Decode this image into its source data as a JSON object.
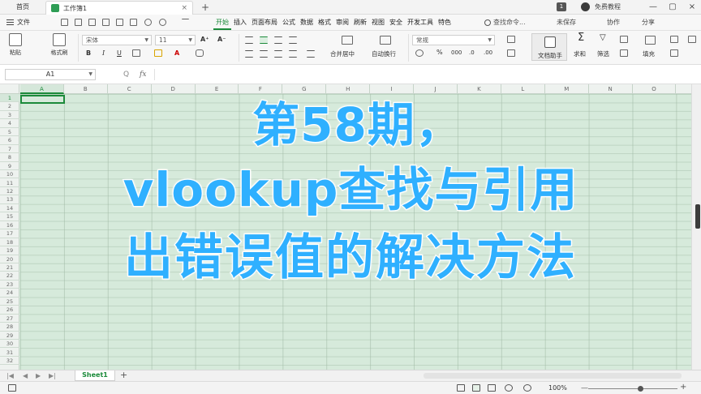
{
  "titlebar": {
    "home_tab": "首页",
    "doc_tab": "工作簿1",
    "close_glyph": "×",
    "add_tab_glyph": "+",
    "window_count": "1",
    "user_name": "免费教程",
    "window_controls": [
      "—",
      "▢",
      "×"
    ]
  },
  "menubar": {
    "file_label": "文件",
    "tabs": [
      {
        "label": "开始",
        "active": true
      },
      {
        "label": "插入",
        "active": false
      },
      {
        "label": "页面布局",
        "active": false
      },
      {
        "label": "公式",
        "active": false
      },
      {
        "label": "数据",
        "active": false
      },
      {
        "label": "格式",
        "active": false
      },
      {
        "label": "审阅",
        "active": false
      },
      {
        "label": "刷新",
        "active": false
      },
      {
        "label": "视图",
        "active": false
      },
      {
        "label": "安全",
        "active": false
      },
      {
        "label": "开发工具",
        "active": false
      },
      {
        "label": "特色",
        "active": false
      }
    ],
    "search_placeholder": "查找命令...",
    "save_status": "未保存",
    "collab": "协作",
    "share": "分享"
  },
  "ribbon": {
    "paste_label": "粘贴",
    "format_painter_label": "格式刷",
    "font_name": "宋体",
    "font_size": "11",
    "bold": "B",
    "italic": "I",
    "underline": "U",
    "merge_label": "合并居中",
    "wrap_label": "自动换行",
    "number_format": "常规",
    "percent": "%",
    "assistant_label": "文档助手",
    "sum_label": "求和",
    "filter_label": "筛选",
    "fill_label": "填充"
  },
  "formulabar": {
    "cell_ref": "A1",
    "fx_label": "fx",
    "zoom_glyph": "Q",
    "formula_value": ""
  },
  "grid": {
    "columns": [
      "A",
      "B",
      "C",
      "D",
      "E",
      "F",
      "G",
      "H",
      "I",
      "J",
      "K",
      "L",
      "M",
      "N",
      "O"
    ],
    "rows": [
      "1",
      "2",
      "3",
      "4",
      "5",
      "6",
      "7",
      "8",
      "9",
      "10",
      "11",
      "12",
      "13",
      "14",
      "15",
      "16",
      "17",
      "18",
      "19",
      "20",
      "21",
      "22",
      "23",
      "24",
      "25",
      "26",
      "27",
      "28",
      "29",
      "30",
      "31",
      "32"
    ],
    "active_cell": "A1"
  },
  "overlay": {
    "line1": "第58期，",
    "line2": "vlookup查找与引用",
    "line3": "出错误值的解决方法",
    "text_color": "#2fb0ff",
    "outline_color": "#ffffff"
  },
  "sheets": {
    "tabs": [
      "Sheet1"
    ],
    "add_glyph": "+"
  },
  "statusbar": {
    "zoom": "100%",
    "zoom_level": 1.0,
    "minus": "—",
    "plus": "+"
  },
  "colors": {
    "accent": "#1b8a3a",
    "grid_background": "#d6eadb"
  }
}
